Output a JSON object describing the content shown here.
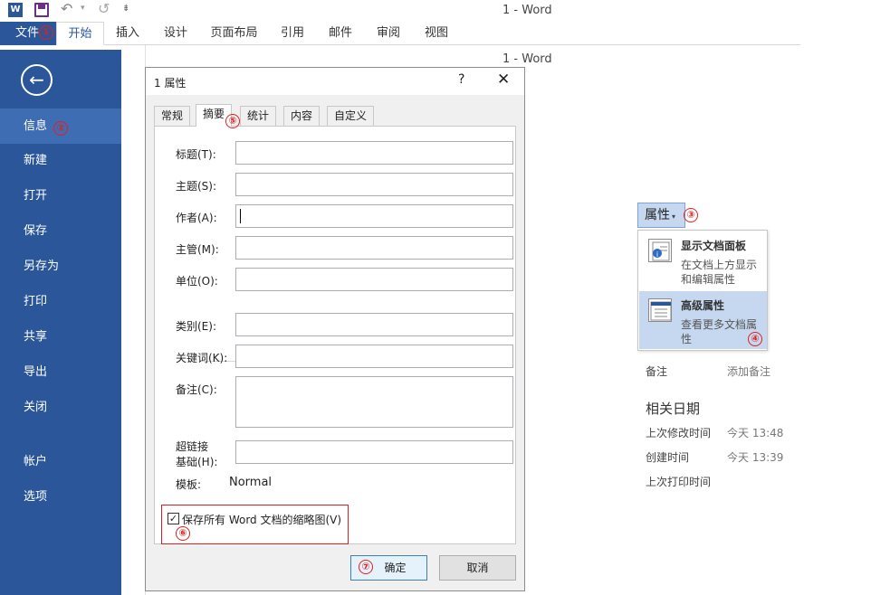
{
  "qat": {
    "word_icon": "W",
    "undo_glyph": "↶",
    "redo_glyph": "↺",
    "caret_glyph": "▾",
    "more_glyph": "⇟"
  },
  "window_title": "1 - Word",
  "ribbon": {
    "file": "文件",
    "tabs": [
      "开始",
      "插入",
      "设计",
      "页面布局",
      "引用",
      "邮件",
      "审阅",
      "视图"
    ],
    "active_tab": "开始"
  },
  "sidebar": {
    "back_glyph": "←",
    "items": [
      "信息",
      "新建",
      "打开",
      "保存",
      "另存为",
      "打印",
      "共享",
      "导出",
      "关闭",
      "帐户",
      "选项"
    ],
    "active": "信息"
  },
  "markers": [
    "①",
    "②",
    "③",
    "④",
    "⑤",
    "⑥",
    "⑦"
  ],
  "properties": {
    "button": "属性",
    "menu": [
      {
        "title": "显示文档面板",
        "desc": "在文档上方显示和编辑属性"
      },
      {
        "title": "高级属性",
        "desc": "查看更多文档属性"
      }
    ],
    "rows": [
      {
        "label": "备注",
        "value": "添加备注"
      }
    ],
    "dates_heading": "相关日期",
    "dates": [
      {
        "label": "上次修改时间",
        "value": "今天 13:48"
      },
      {
        "label": "创建时间",
        "value": "今天 13:39"
      },
      {
        "label": "上次打印时间",
        "value": ""
      }
    ]
  },
  "dialog": {
    "title": "1 属性",
    "help": "?",
    "close": "✕",
    "tabs": [
      "常规",
      "摘要",
      "统计",
      "内容",
      "自定义"
    ],
    "active_tab": "摘要",
    "fields": [
      {
        "label": "标题(T):",
        "value": ""
      },
      {
        "label": "主题(S):",
        "value": ""
      },
      {
        "label": "作者(A):",
        "value": ""
      },
      {
        "label": "主管(M):",
        "value": ""
      },
      {
        "label": "单位(O):",
        "value": ""
      },
      {
        "label": "类别(E):",
        "value": ""
      },
      {
        "label": "关键词(K):",
        "value": ""
      },
      {
        "label": "备注(C):",
        "value": ""
      },
      {
        "label": "超链接基础(H):",
        "label_line1": "超链接",
        "label_line2": "基础(H):",
        "value": ""
      }
    ],
    "template_label": "模板:",
    "template_value": "Normal",
    "checkbox_label": "保存所有 Word 文档的缩略图(V)",
    "checkbox_checked": true,
    "check_glyph": "✓",
    "ok": "确定",
    "cancel": "取消"
  }
}
